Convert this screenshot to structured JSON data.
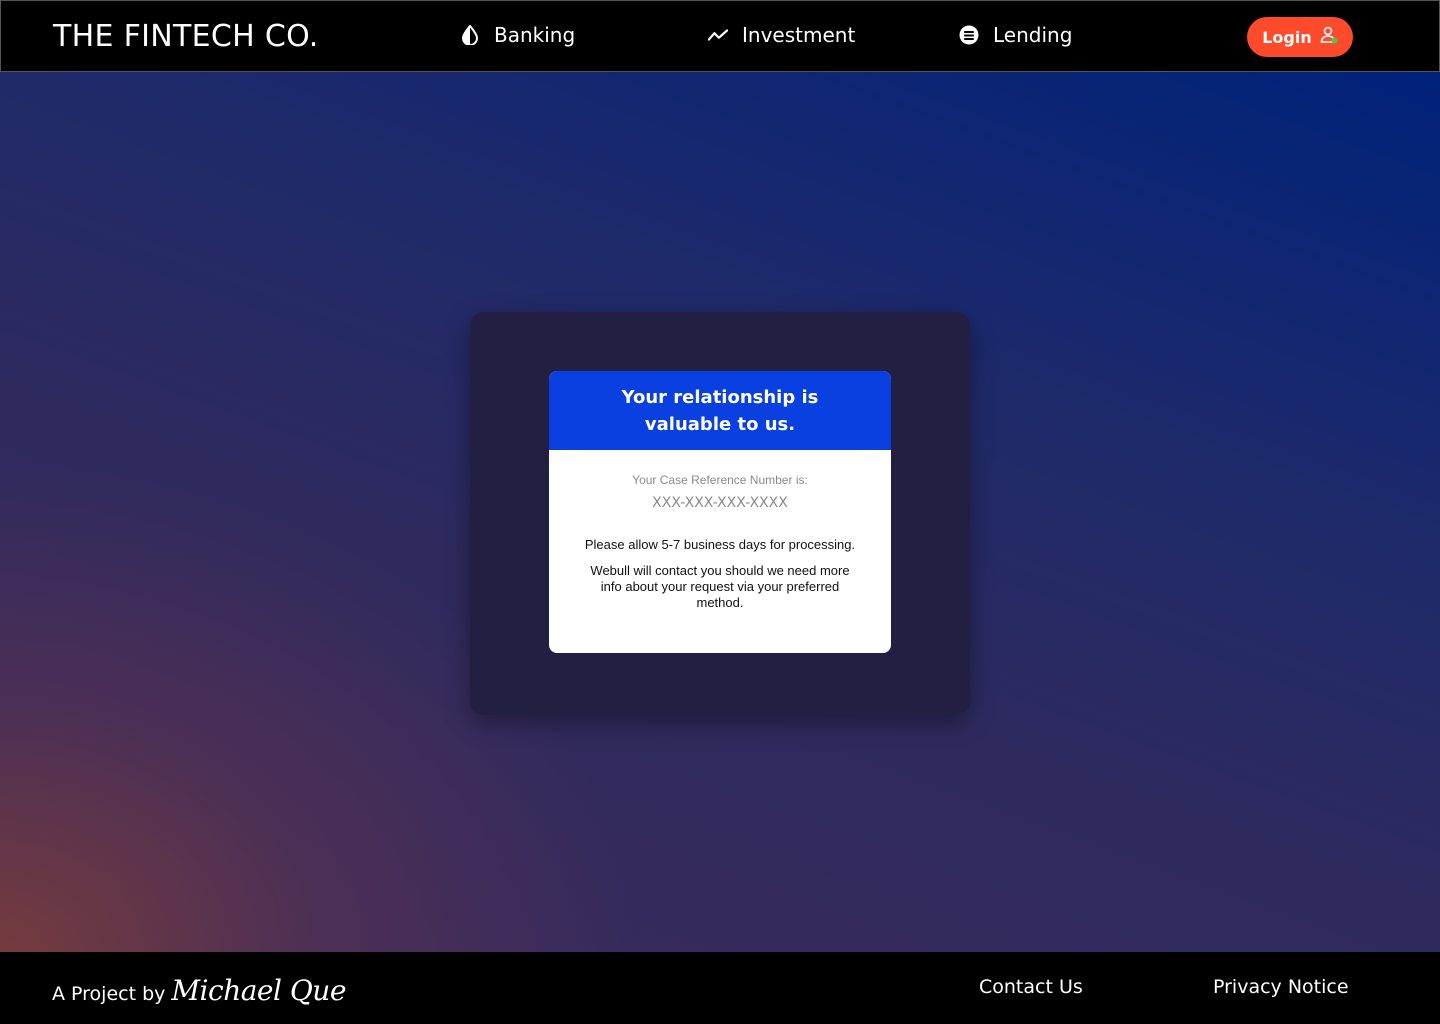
{
  "header": {
    "brand": "THE FINTECH CO.",
    "nav": [
      {
        "label": "Banking",
        "icon": "contrast-drop-icon"
      },
      {
        "label": "Investment",
        "icon": "trend-line-icon"
      },
      {
        "label": "Lending",
        "icon": "coins-icon"
      }
    ],
    "login_label": "Login"
  },
  "modal": {
    "title": "Your relationship is valuable to us.",
    "case_label": "Your Case Reference Number is:",
    "case_number": "XXX-XXX-XXX-XXXX",
    "processing_note": "Please allow 5-7 business days for processing.",
    "contact_note": "Webull will contact you should we need more info about your request via  your preferred method."
  },
  "footer": {
    "project_prefix": "A Project by",
    "signature": "Michael Que",
    "links": [
      "Contact Us",
      "Privacy Notice"
    ]
  },
  "colors": {
    "login_button": "#ff4b2b",
    "modal_header": "#0a40e0",
    "outer_card": "#221f43"
  }
}
